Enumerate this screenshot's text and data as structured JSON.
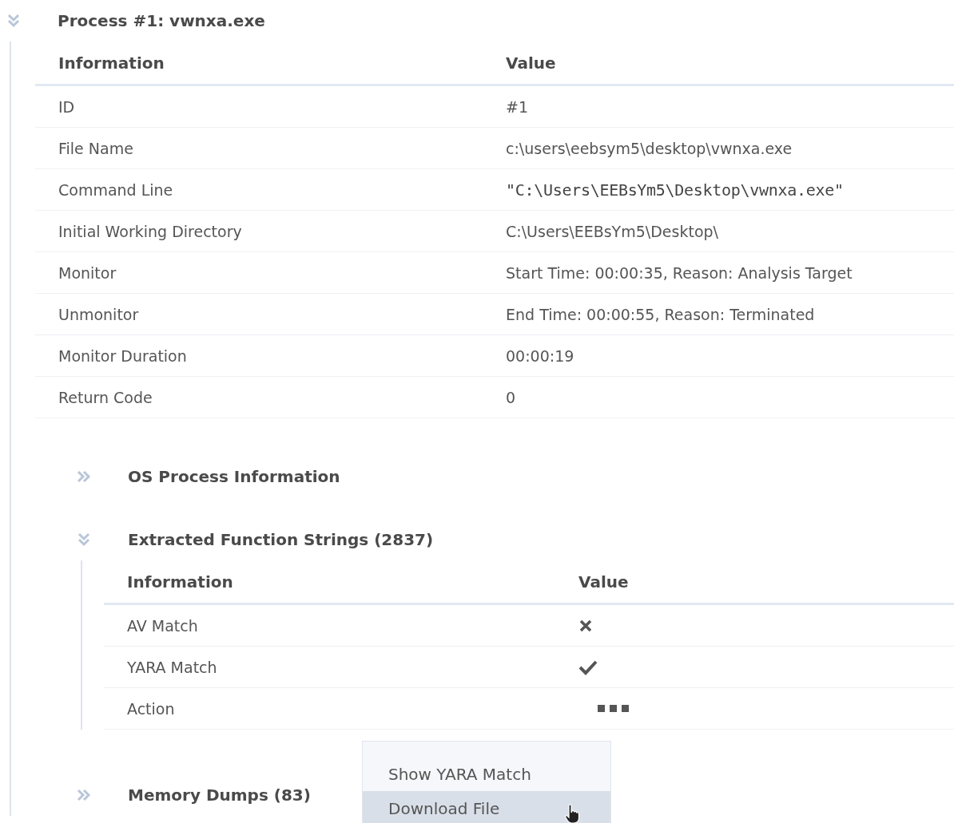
{
  "process": {
    "title": "Process #1: vwnxa.exe",
    "expanded": true,
    "columns": [
      "Information",
      "Value"
    ],
    "rows": [
      {
        "label": "ID",
        "kind": "text",
        "value": "#1"
      },
      {
        "label": "File Name",
        "kind": "text",
        "value": "c:\\users\\eebsym5\\desktop\\vwnxa.exe"
      },
      {
        "label": "Command Line",
        "kind": "mono",
        "value": "\"C:\\Users\\EEBsYm5\\Desktop\\vwnxa.exe\""
      },
      {
        "label": "Initial Working Directory",
        "kind": "text",
        "value": "C:\\Users\\EEBsYm5\\Desktop\\"
      },
      {
        "label": "Monitor",
        "kind": "text",
        "value": "Start Time: 00:00:35, Reason: Analysis Target"
      },
      {
        "label": "Unmonitor",
        "kind": "text",
        "value": "End Time: 00:00:55, Reason: Terminated"
      },
      {
        "label": "Monitor Duration",
        "kind": "text",
        "value": "00:00:19"
      },
      {
        "label": "Return Code",
        "kind": "text",
        "value": "0"
      }
    ],
    "sections": [
      {
        "title": "OS Process Information",
        "expanded": false
      },
      {
        "title": "Extracted Function Strings (2837)",
        "expanded": true,
        "columns": [
          "Information",
          "Value"
        ],
        "rows": [
          {
            "label": "AV Match",
            "kind": "cross"
          },
          {
            "label": "YARA Match",
            "kind": "check"
          },
          {
            "label": "Action",
            "kind": "more",
            "menu": [
              {
                "label": "Show YARA Match",
                "selected": false
              },
              {
                "label": "Download File",
                "selected": true
              }
            ]
          }
        ]
      },
      {
        "title": "Memory Dumps (83)",
        "expanded": false
      }
    ]
  }
}
